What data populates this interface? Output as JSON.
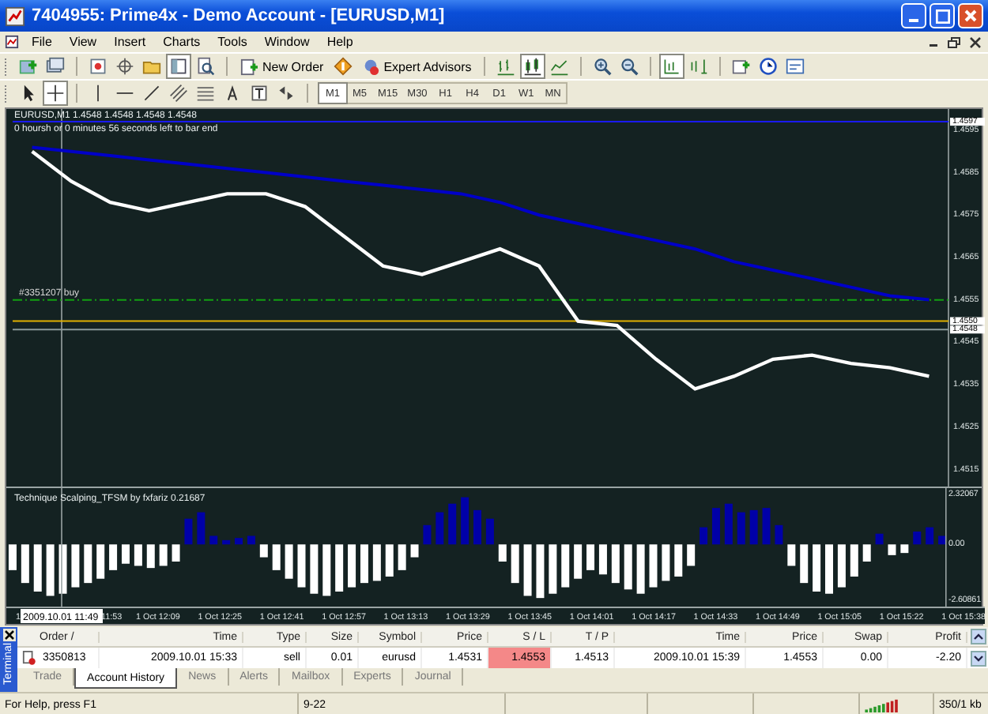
{
  "window": {
    "title": "7404955: Prime4x - Demo Account - [EURUSD,M1]"
  },
  "menu": [
    "File",
    "View",
    "Insert",
    "Charts",
    "Tools",
    "Window",
    "Help"
  ],
  "toolbar": {
    "new_order": "New Order",
    "expert_advisors": "Expert Advisors"
  },
  "timeframes": [
    {
      "label": "M1",
      "selected": true
    },
    {
      "label": "M5",
      "selected": false
    },
    {
      "label": "M15",
      "selected": false
    },
    {
      "label": "M30",
      "selected": false
    },
    {
      "label": "H1",
      "selected": false
    },
    {
      "label": "H4",
      "selected": false
    },
    {
      "label": "D1",
      "selected": false
    },
    {
      "label": "W1",
      "selected": false
    },
    {
      "label": "MN",
      "selected": false
    }
  ],
  "chart": {
    "header": "EURUSD,M1 1.4548 1.4548 1.4548 1.4548",
    "timer": "0 hoursh or 0 minutes 56 seconds left to bar end",
    "crosshair_label": "2009.10.01 11:49",
    "chart_data": {
      "type": "line",
      "ylim": [
        1.4511,
        1.46
      ],
      "categories": [
        null,
        null,
        null,
        null,
        null,
        null,
        null,
        null,
        null,
        null,
        null,
        null,
        null,
        null,
        null,
        null,
        null,
        null,
        null,
        null,
        null,
        null,
        null,
        null
      ],
      "series": [
        {
          "color": "#ffffff",
          "values": [
            1.459,
            1.4583,
            1.4578,
            1.4576,
            1.4578,
            1.458,
            1.458,
            1.4577,
            1.457,
            1.4563,
            1.4561,
            1.4564,
            1.4567,
            1.4563,
            1.455,
            1.4549,
            1.4541,
            1.4534,
            1.4537,
            1.4541,
            1.4542,
            1.454,
            1.4539,
            1.4537
          ]
        },
        {
          "color": "#0000c8",
          "values": [
            1.4591,
            1.459,
            1.4589,
            1.4588,
            1.4587,
            1.4586,
            1.4585,
            1.4584,
            1.4583,
            1.4582,
            1.4581,
            1.458,
            1.4578,
            1.4575,
            1.4573,
            1.4571,
            1.4569,
            1.4567,
            1.4564,
            1.4562,
            1.456,
            1.4558,
            1.4556,
            1.4555
          ]
        }
      ],
      "yticks": [
        1.4595,
        1.4585,
        1.4575,
        1.4565,
        1.4555,
        1.4545,
        1.4535,
        1.4525,
        1.4515
      ],
      "ref_lines": [
        {
          "axis": "y",
          "value": 1.4597,
          "label": "1.4597",
          "color": "#1a1aff"
        },
        {
          "axis": "y",
          "value": 1.4555,
          "color": "#12a012"
        },
        {
          "axis": "y",
          "value": 1.455,
          "label": "1.4550",
          "color": "#e0b000"
        },
        {
          "axis": "y",
          "value": 1.4548,
          "label": "1.4548",
          "color": "#8a9a9a"
        }
      ],
      "annotations": [
        "#3351207 buy"
      ]
    },
    "indicator": {
      "label": "Technique Scalping_TFSM by fxfariz 0.21687",
      "chart_data": {
        "type": "bar",
        "ylim": [
          -2.9,
          2.7
        ],
        "values": [
          -1.2,
          -1.8,
          -2.2,
          -2.4,
          -2.3,
          -2.0,
          -1.8,
          -1.6,
          -1.2,
          -0.9,
          -1.0,
          -1.1,
          -1.0,
          -0.8,
          1.2,
          1.5,
          0.4,
          0.2,
          0.3,
          0.4,
          -0.6,
          -1.2,
          -1.6,
          -2.0,
          -2.3,
          -2.4,
          -2.2,
          -2.0,
          -1.8,
          -1.7,
          -1.5,
          -1.2,
          -0.6,
          0.9,
          1.5,
          1.9,
          2.2,
          1.6,
          1.2,
          -0.8,
          -1.8,
          -2.4,
          -2.5,
          -2.3,
          -2.0,
          -1.6,
          -1.2,
          -1.4,
          -1.8,
          -2.1,
          -2.3,
          -2.0,
          -1.7,
          -1.5,
          -1.0,
          0.8,
          1.7,
          1.9,
          1.5,
          1.6,
          1.7,
          0.9,
          -1.0,
          -1.8,
          -2.2,
          -2.3,
          -2.0,
          -1.5,
          -0.8,
          0.5,
          -0.5,
          -0.4,
          0.6,
          0.8,
          0.4
        ],
        "yticks": [
          2.32067,
          {
            "value": 0,
            "label": "0.00"
          },
          -2.60861
        ]
      }
    },
    "time_axis": [
      "1",
      "11:53",
      "1 Oct 12:09",
      "1 Oct 12:25",
      "1 Oct 12:41",
      "1 Oct 12:57",
      "1 Oct 13:13",
      "1 Oct 13:29",
      "1 Oct 13:45",
      "1 Oct 14:01",
      "1 Oct 14:17",
      "1 Oct 14:33",
      "1 Oct 14:49",
      "1 Oct 15:05",
      "1 Oct 15:22",
      "1 Oct 15:38"
    ]
  },
  "terminal": {
    "side_label": "Terminal",
    "columns": [
      "Order /",
      "Time",
      "Type",
      "Size",
      "Symbol",
      "Price",
      "S / L",
      "T / P",
      "Time",
      "Price",
      "Swap",
      "Profit"
    ],
    "rows": [
      {
        "cells": [
          "3350813",
          "2009.10.01 15:33",
          "sell",
          "0.01",
          "eurusd",
          "1.4531",
          "1.4553",
          "1.4513",
          "2009.10.01 15:39",
          "1.4553",
          "0.00",
          "-2.20"
        ],
        "stop_loss_hit": true
      }
    ],
    "tabs": [
      {
        "label": "Trade",
        "selected": false
      },
      {
        "label": "Account History",
        "selected": true
      },
      {
        "label": "News",
        "selected": false
      },
      {
        "label": "Alerts",
        "selected": false
      },
      {
        "label": "Mailbox",
        "selected": false
      },
      {
        "label": "Experts",
        "selected": false
      },
      {
        "label": "Journal",
        "selected": false
      }
    ]
  },
  "status_bar": {
    "help": "For Help, press F1",
    "profile": "9-22",
    "traffic": "350/1 kb"
  }
}
